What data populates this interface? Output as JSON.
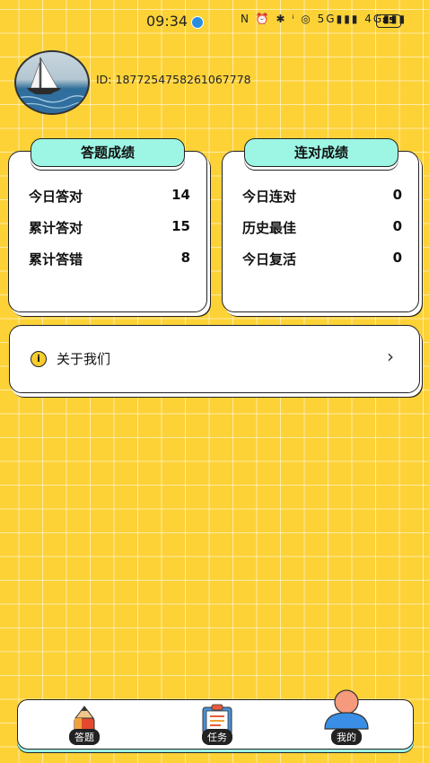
{
  "status_bar": {
    "time": "09:34",
    "icons_text": "N ⏰ ✱ ⁱ ◎ 5G▮▮▮ 4G▮▮▮",
    "battery": "85"
  },
  "profile": {
    "id_text": "ID: 1877254758261067778"
  },
  "answer_card": {
    "title": "答题成绩",
    "rows": [
      {
        "label": "今日答对",
        "value": "14"
      },
      {
        "label": "累计答对",
        "value": "15"
      },
      {
        "label": "累计答错",
        "value": "8"
      }
    ]
  },
  "streak_card": {
    "title": "连对成绩",
    "rows": [
      {
        "label": "今日连对",
        "value": "0"
      },
      {
        "label": "历史最佳",
        "value": "0"
      },
      {
        "label": "今日复活",
        "value": "0"
      }
    ]
  },
  "about": {
    "label": "关于我们",
    "arrow": "›"
  },
  "tabbar": {
    "tabs": [
      {
        "label": "答题",
        "icon": "pencil-icon"
      },
      {
        "label": "任务",
        "icon": "clipboard-icon"
      },
      {
        "label": "我的",
        "icon": "user-icon"
      }
    ],
    "active_index": 2
  },
  "colors": {
    "background": "#fdd237",
    "tab_teal": "#9df5e4",
    "card_white": "#ffffff"
  }
}
